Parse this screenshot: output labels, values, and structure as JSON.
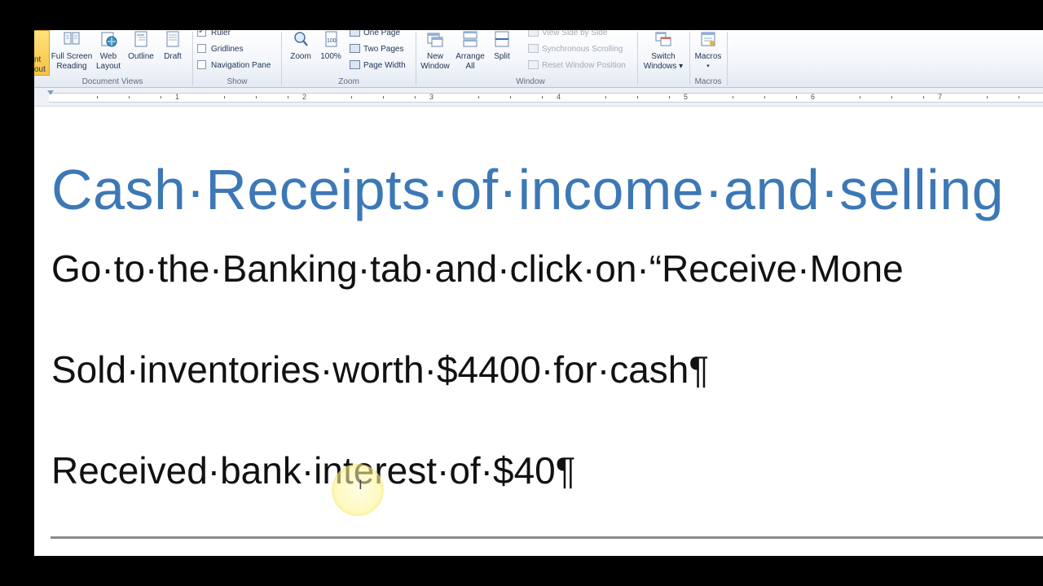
{
  "ribbon": {
    "document_views": {
      "group_label": "Document Views",
      "partial_label_top": "nt",
      "partial_label_bottom": "out",
      "buttons": [
        {
          "line1": "Full Screen",
          "line2": "Reading"
        },
        {
          "line1": "Web",
          "line2": "Layout"
        },
        {
          "line1": "Outline",
          "line2": ""
        },
        {
          "line1": "Draft",
          "line2": ""
        }
      ]
    },
    "show": {
      "group_label": "Show",
      "ruler": "Ruler",
      "gridlines": "Gridlines",
      "navigation_pane": "Navigation Pane"
    },
    "zoom": {
      "group_label": "Zoom",
      "zoom_button": "Zoom",
      "hundred_button": "100%",
      "one_page": "One Page",
      "two_pages": "Two Pages",
      "page_width": "Page Width"
    },
    "window": {
      "group_label": "Window",
      "new_window": {
        "line1": "New",
        "line2": "Window"
      },
      "arrange_all": {
        "line1": "Arrange",
        "line2": "All"
      },
      "split": "Split",
      "view_side_by_side": "View Side by Side",
      "synchronous_scrolling": "Synchronous Scrolling",
      "reset_window_position": "Reset Window Position",
      "switch_windows": {
        "line1": "Switch",
        "line2": "Windows ▾"
      }
    },
    "macros": {
      "group_label": "Macros",
      "button": "Macros",
      "arrow": "▾"
    }
  },
  "ruler": {
    "numbers": [
      "1",
      "2",
      "3",
      "4",
      "5",
      "6",
      "7"
    ]
  },
  "document": {
    "heading": "Cash·Receipts·of·income·and·selling",
    "line1": "Go·to·the·Banking·tab·and·click·on·“Receive·Mone",
    "line2": "Sold·inventories·worth·$4400·for·cash¶",
    "line3": "Received·bank·interest·of·$40¶"
  },
  "colors": {
    "heading": "#3d78b6",
    "body_text": "#111111",
    "cursor_highlight": "#f2ec6a"
  },
  "cursor": {
    "icon": "i-beam-icon",
    "glyph": "I"
  }
}
